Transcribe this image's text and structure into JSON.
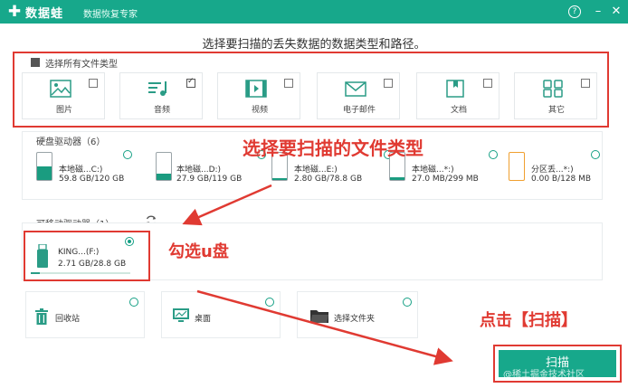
{
  "app": {
    "logo_glyph": "✚",
    "name": "数据蛙",
    "subtitle": "数据恢复专家",
    "help_glyph": "?",
    "minimize_glyph": "–",
    "close_glyph": "✕"
  },
  "heading": "选择要扫描的丢失数据的数据类型和路径。",
  "file_types": {
    "select_all_label": "选择所有文件类型",
    "select_all_checked": true,
    "items": [
      {
        "label": "图片",
        "icon": "image-icon",
        "checked": false
      },
      {
        "label": "音频",
        "icon": "audio-icon",
        "checked": true
      },
      {
        "label": "视频",
        "icon": "video-icon",
        "checked": false
      },
      {
        "label": "电子邮件",
        "icon": "email-icon",
        "checked": false
      },
      {
        "label": "文档",
        "icon": "document-icon",
        "checked": false
      },
      {
        "label": "其它",
        "icon": "other-icon",
        "checked": false
      }
    ]
  },
  "hard_drives": {
    "label": "硬盘驱动器（6）",
    "items": [
      {
        "name": "本地磁...C:)",
        "size": "59.8 GB/120 GB",
        "fill_pct": 50,
        "fill_color": "#1a9c80",
        "selected": false
      },
      {
        "name": "本地磁...D:)",
        "size": "27.9 GB/119 GB",
        "fill_pct": 24,
        "fill_color": "#1a9c80",
        "selected": false
      },
      {
        "name": "本地磁...E:)",
        "size": "2.80 GB/78.8 GB",
        "fill_pct": 6,
        "fill_color": "#1a9c80",
        "selected": false
      },
      {
        "name": "本地磁...*:)",
        "size": "27.0 MB/299 MB",
        "fill_pct": 10,
        "fill_color": "#1a9c80",
        "selected": false
      },
      {
        "name": "分区丢...*:)",
        "size": "0.00  B/128 MB",
        "fill_pct": 0,
        "fill_color": "#f0a030",
        "selected": false
      }
    ]
  },
  "removable": {
    "label": "可移动驱动器（1）",
    "refresh_icon": "refresh-icon",
    "item": {
      "name": "KING...(F:)",
      "size": "2.71 GB/28.8 GB",
      "usage_pct": 9,
      "selected": true
    }
  },
  "locations": [
    {
      "label": "回收站",
      "icon": "recycle-bin-icon",
      "selected": false
    },
    {
      "label": "桌面",
      "icon": "desktop-icon",
      "selected": false
    },
    {
      "label": "选择文件夹",
      "icon": "folder-icon",
      "selected": false
    }
  ],
  "annotations": {
    "file_type": "选择要扫描的文件类型",
    "usb": "勾选u盘",
    "scan": "点击【扫描】"
  },
  "scan_button": "扫描",
  "watermark": "@稀土掘金技术社区",
  "colors": {
    "accent": "#17a88b",
    "annotation": "#e03a32"
  }
}
